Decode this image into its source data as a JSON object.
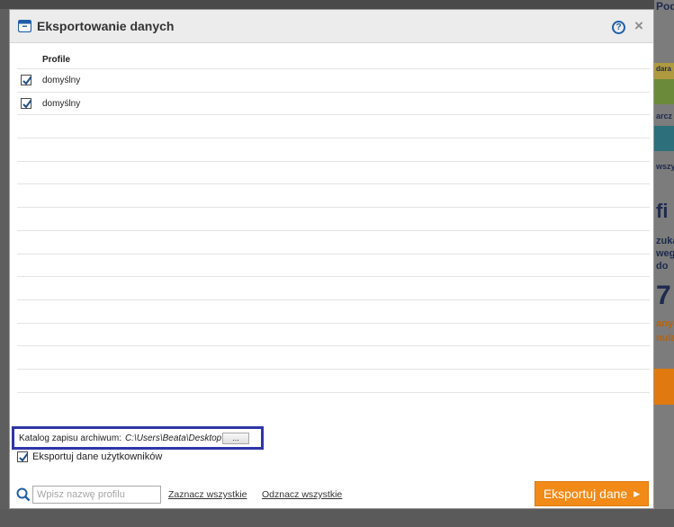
{
  "dialog": {
    "title": "Eksportowanie danych",
    "help_label": "?",
    "close_label": "×"
  },
  "table": {
    "header": "Profile",
    "rows": [
      {
        "name": "domyślny",
        "checked": true
      },
      {
        "name": "domyślny",
        "checked": true
      },
      {
        "name": "",
        "checked": false
      },
      {
        "name": "",
        "checked": false
      },
      {
        "name": "",
        "checked": false
      },
      {
        "name": "",
        "checked": false
      },
      {
        "name": "",
        "checked": false
      },
      {
        "name": "",
        "checked": false
      },
      {
        "name": "",
        "checked": false
      },
      {
        "name": "",
        "checked": false
      },
      {
        "name": "",
        "checked": false
      },
      {
        "name": "",
        "checked": false
      },
      {
        "name": "",
        "checked": false
      },
      {
        "name": "",
        "checked": false
      }
    ]
  },
  "archive": {
    "label": "Katalog zapisu archiwum:",
    "path": "C:\\Users\\Beata\\Desktop",
    "browse_label": "..."
  },
  "export_users": {
    "label": "Eksportuj dane użytkowników",
    "checked": true
  },
  "bottom": {
    "search_placeholder": "Wpisz nazwę profilu",
    "select_all": "Zaznacz wszystkie",
    "deselect_all": "Odznacz wszystkie",
    "export_button": "Eksportuj dane",
    "export_arrow": "▶"
  },
  "colors": {
    "accent_orange": "#f28a18",
    "highlight_blue": "#2f35a8",
    "icon_blue": "#1f5fa8"
  },
  "background_app": {
    "labels": [
      "Podsumo",
      "dara",
      "arcz",
      "wszy",
      "fi",
      "zuka",
      "weg",
      "do",
      "7",
      "anyc",
      "nula"
    ]
  }
}
